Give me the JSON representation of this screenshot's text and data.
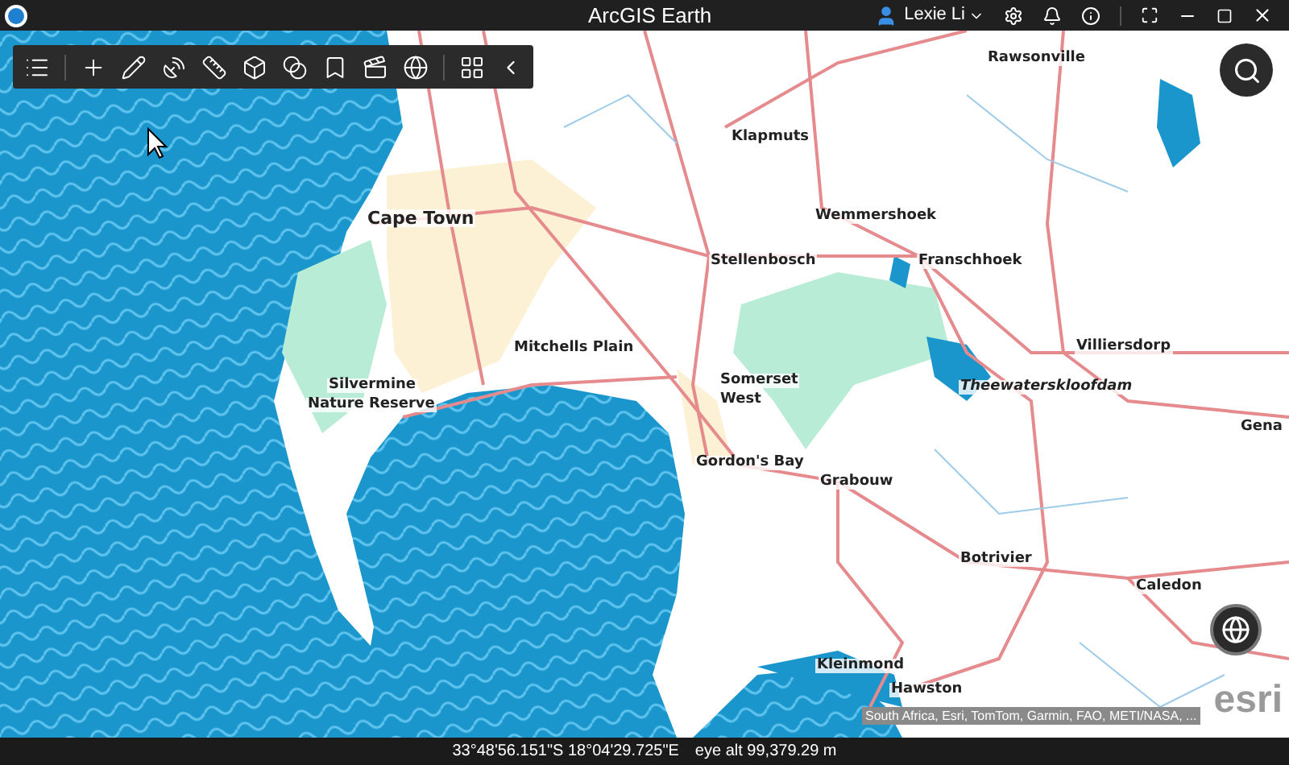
{
  "window": {
    "title": "ArcGIS Earth"
  },
  "user": {
    "name": "Lexie Li"
  },
  "map": {
    "labels": [
      {
        "text": "Rawsonville",
        "kind": "town"
      },
      {
        "text": "Klapmuts",
        "kind": "town"
      },
      {
        "text": "Cape Town",
        "kind": "city"
      },
      {
        "text": "Wemmershoek",
        "kind": "town"
      },
      {
        "text": "Stellenbosch",
        "kind": "town"
      },
      {
        "text": "Franschhoek",
        "kind": "town"
      },
      {
        "text": "Mitchells Plain",
        "kind": "town"
      },
      {
        "text": "Villiersdorp",
        "kind": "town"
      },
      {
        "text": "Silvermine",
        "kind": "town"
      },
      {
        "text": "Nature Reserve",
        "kind": "town"
      },
      {
        "text": "Somerset",
        "kind": "town"
      },
      {
        "text": "West",
        "kind": "town"
      },
      {
        "text": "Theewaterskloofdam",
        "kind": "water"
      },
      {
        "text": "Gena",
        "kind": "town"
      },
      {
        "text": "Gordon's Bay",
        "kind": "town"
      },
      {
        "text": "Grabouw",
        "kind": "town"
      },
      {
        "text": "Botrivier",
        "kind": "town"
      },
      {
        "text": "Caledon",
        "kind": "town"
      },
      {
        "text": "Kleinmond",
        "kind": "town"
      },
      {
        "text": "Hawston",
        "kind": "town"
      }
    ],
    "attribution": "South Africa, Esri, TomTom, Garmin, FAO, METI/NASA, ...",
    "logo": "esri"
  },
  "status_bar": {
    "coordinates": "33°48'56.151\"S 18°04'29.725\"E",
    "altitude": "eye alt 99,379.29 m"
  }
}
